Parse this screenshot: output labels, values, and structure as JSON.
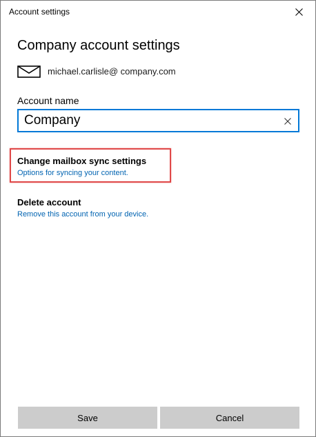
{
  "window": {
    "title": "Account settings",
    "close_icon": "close-icon"
  },
  "header": {
    "title": "Company account settings"
  },
  "account": {
    "icon": "mail-icon",
    "email": "michael.carlisle@ company.com"
  },
  "account_name": {
    "label": "Account name",
    "value": "Company",
    "clear_icon": "clear-icon"
  },
  "options": {
    "sync": {
      "title": "Change mailbox sync settings",
      "description": "Options for syncing your content."
    },
    "delete": {
      "title": "Delete account",
      "description": "Remove this account from your device."
    }
  },
  "footer": {
    "save_label": "Save",
    "cancel_label": "Cancel"
  },
  "colors": {
    "accent": "#0078d7",
    "link": "#0063b1",
    "highlight": "#e04848",
    "button_bg": "#cccccc"
  }
}
